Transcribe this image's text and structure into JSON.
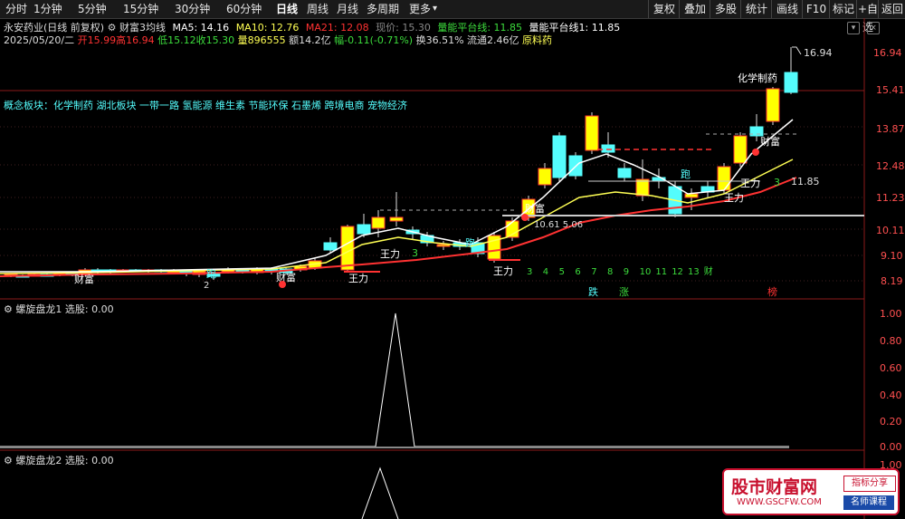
{
  "toolbar": {
    "items": [
      "分时",
      "1分钟",
      "5分钟",
      "15分钟",
      "30分钟",
      "60分钟",
      "日线",
      "周线",
      "月线",
      "多周期",
      "更多"
    ],
    "active": "日线",
    "more_arrow": "▾",
    "right_buttons": [
      "复权",
      "叠加",
      "多股",
      "统计",
      "画线",
      "F10",
      "标记",
      "+自选",
      "返回"
    ]
  },
  "header": {
    "stock": "永安药业(日线 前复权)",
    "indicator": "财富3均线",
    "ma5": "MA5: 14.16",
    "ma10": "MA10: 12.76",
    "ma21": "MA21: 12.08",
    "price_now": "现价: 15.30",
    "platform": "量能平台线: 11.85",
    "platform1": "量能平台线1: 11.85"
  },
  "quote": {
    "date": "2025/05/20/二",
    "open": "开15.99",
    "high": "高16.94",
    "low": "低15.12",
    "close": "收15.30",
    "volume": "量896555",
    "amount": "额14.2亿",
    "change": "幅-0.11(-0.71%)",
    "turnover": "换36.51%",
    "float": "流通2.46亿",
    "sector": "原料药"
  },
  "concept": "概念板块：化学制药 湖北板块 一带一路 氢能源 维生素 节能环保 石墨烯 跨境电商 宠物经济",
  "price_axis": [
    "16.94",
    "15.41",
    "13.87",
    "12.48",
    "11.23",
    "10.11",
    "9.10",
    "8.19"
  ],
  "chart_data": {
    "type": "candlestick",
    "ohlc_recent": [
      {
        "label": "last",
        "open": 15.99,
        "high": 16.94,
        "low": 15.12,
        "close": 15.3
      }
    ],
    "ma": {
      "MA5": 14.16,
      "MA10": 12.76,
      "MA21": 12.08
    },
    "platform_line": 11.85,
    "annotations": [
      "化学制药",
      "财富",
      "王力",
      "跑",
      "16.94",
      "11.85",
      "10.61",
      "5.06",
      "2",
      "3",
      "4",
      "5",
      "6",
      "7",
      "8",
      "9",
      "10",
      "11",
      "12",
      "13",
      "财",
      "跌",
      "涨",
      "榜"
    ]
  },
  "panel1": {
    "title": "螺旋盘龙1",
    "select": "选股: 0.00",
    "axis": [
      "1.00",
      "0.80",
      "0.60",
      "0.40",
      "0.20",
      "0.00"
    ]
  },
  "panel2": {
    "title": "螺旋盘龙2",
    "select": "选股: 0.00",
    "axis": [
      "1.00"
    ]
  },
  "watermark": {
    "title": "股市财富网",
    "url": "WWW.GSCFW.COM",
    "tag1": "指标分享",
    "tag2": "名师课程"
  },
  "colors": {
    "up": "#ff3232",
    "down": "#54fcfc",
    "yellow": "#ffff00",
    "ma5": "#ffffff",
    "ma10": "#ffff54",
    "ma21": "#ff3232"
  }
}
